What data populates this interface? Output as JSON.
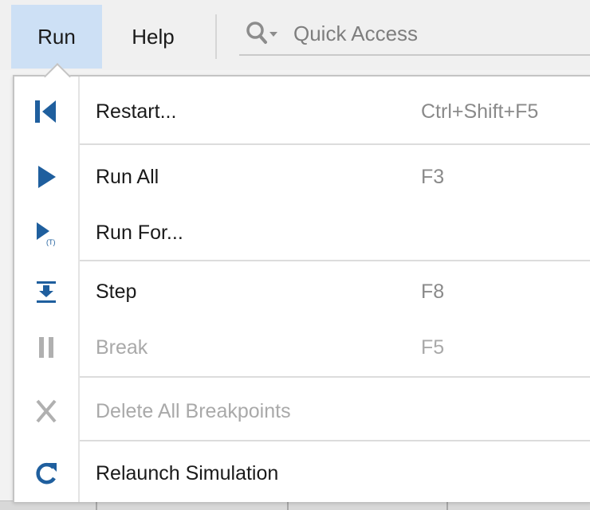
{
  "menubar": {
    "items": [
      {
        "label": "Run",
        "active": true
      },
      {
        "label": "Help",
        "active": false
      }
    ],
    "quick_access": {
      "placeholder": "Quick Access",
      "icon": "search-dropdown-icon"
    }
  },
  "run_menu": {
    "items": [
      {
        "label": "Restart...",
        "shortcut": "Ctrl+Shift+F5",
        "icon": "restart-icon",
        "enabled": true
      },
      {
        "label": "Run All",
        "shortcut": "F3",
        "icon": "play-icon",
        "enabled": true
      },
      {
        "label": "Run For...",
        "shortcut": "",
        "icon": "run-for-time-icon",
        "icon_text": "(T)",
        "enabled": true
      },
      {
        "label": "Step",
        "shortcut": "F8",
        "icon": "step-icon",
        "enabled": true
      },
      {
        "label": "Break",
        "shortcut": "F5",
        "icon": "pause-icon",
        "enabled": false
      },
      {
        "label": "Delete All Breakpoints",
        "shortcut": "",
        "icon": "delete-x-icon",
        "enabled": false
      },
      {
        "label": "Relaunch Simulation",
        "shortcut": "",
        "icon": "relaunch-icon",
        "enabled": true
      }
    ]
  },
  "colors": {
    "menu_active_bg": "#cde0f5",
    "icon_blue": "#1f5f9e",
    "disabled": "#a9a9a9"
  }
}
